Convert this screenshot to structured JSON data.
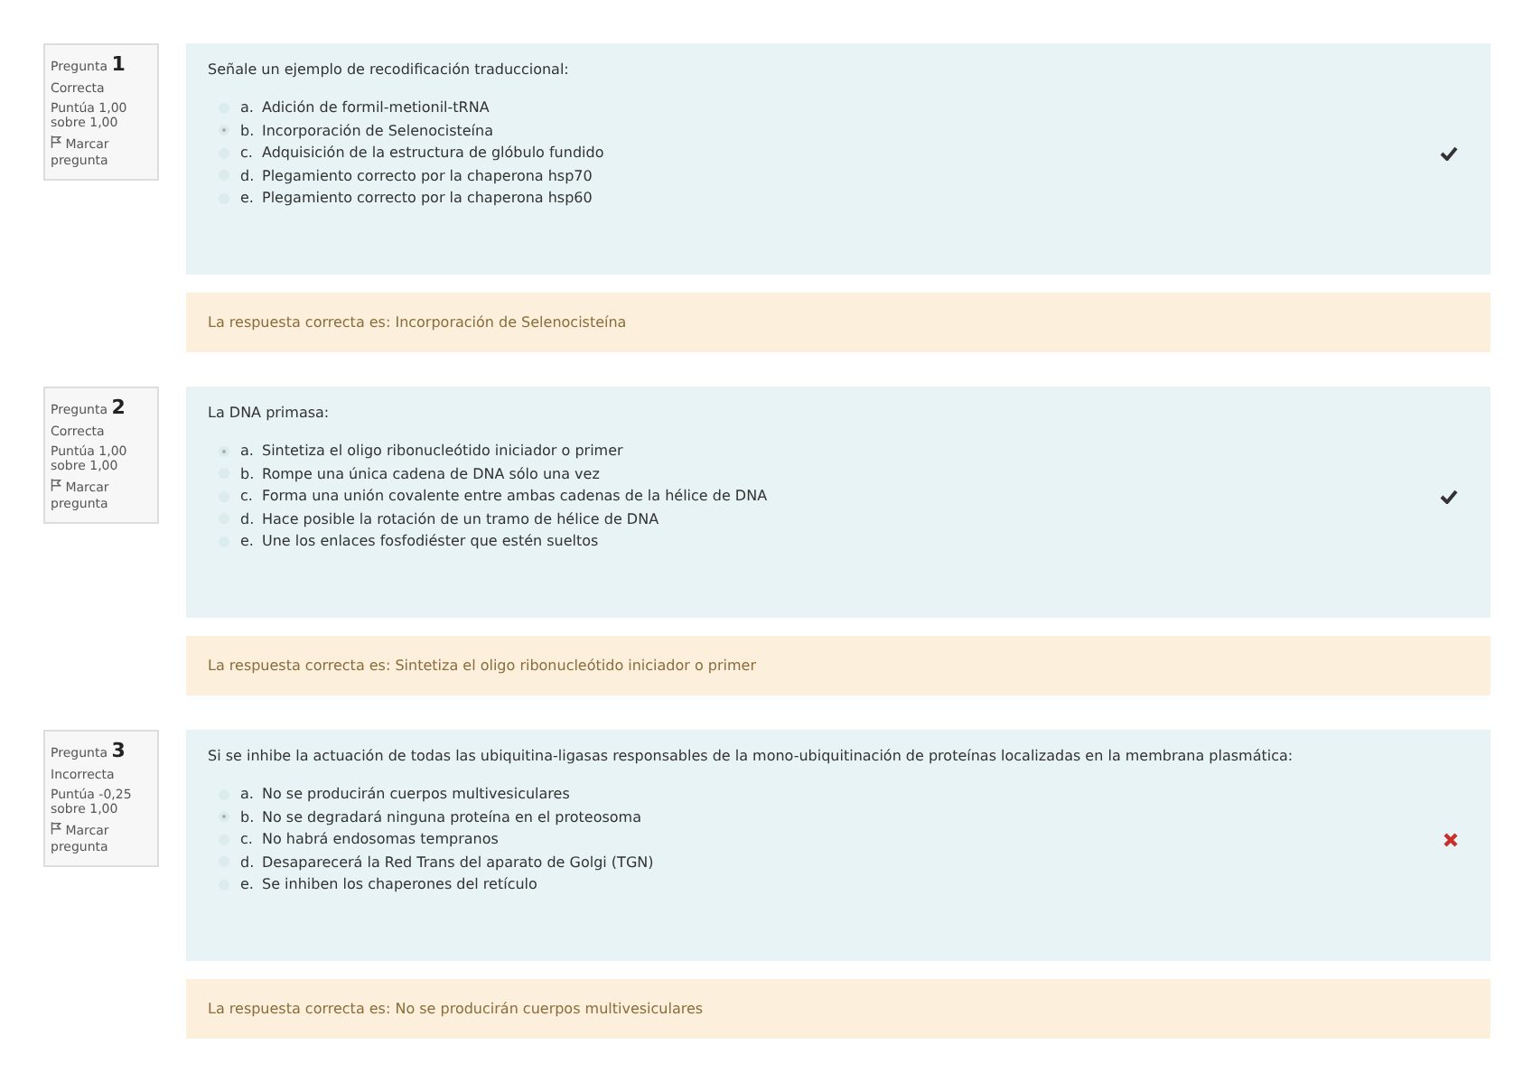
{
  "questions": [
    {
      "label": "Pregunta",
      "number": "1",
      "status": "Correcta",
      "score": "Puntúa 1,00 sobre 1,00",
      "flag": "Marcar pregunta",
      "kind": "correct",
      "text": "Señale un ejemplo de recodificación traduccional:",
      "options": [
        {
          "letter": "a.",
          "text": "Adición de formil-metionil-tRNA",
          "selected": false
        },
        {
          "letter": "b.",
          "text": "Incorporación de Selenocisteína",
          "selected": true
        },
        {
          "letter": "c.",
          "text": "Adquisición de la estructura de glóbulo fundido",
          "selected": false
        },
        {
          "letter": "d.",
          "text": "Plegamiento correcto por la chaperona hsp70",
          "selected": false
        },
        {
          "letter": "e.",
          "text": "Plegamiento correcto por la chaperona hsp60",
          "selected": false
        }
      ],
      "feedback": "La respuesta correcta es: Incorporación de Selenocisteína"
    },
    {
      "label": "Pregunta",
      "number": "2",
      "status": "Correcta",
      "score": "Puntúa 1,00 sobre 1,00",
      "flag": "Marcar pregunta",
      "kind": "correct",
      "text": "La DNA primasa:",
      "options": [
        {
          "letter": "a.",
          "text": "Sintetiza el oligo ribonucleótido iniciador o primer",
          "selected": true
        },
        {
          "letter": "b.",
          "text": "Rompe una única cadena de DNA sólo una vez",
          "selected": false
        },
        {
          "letter": "c.",
          "text": "Forma una unión covalente entre ambas cadenas de la hélice de DNA",
          "selected": false
        },
        {
          "letter": "d.",
          "text": "Hace posible la rotación de un tramo de hélice de DNA",
          "selected": false
        },
        {
          "letter": "e.",
          "text": "Une los enlaces fosfodiéster que estén sueltos",
          "selected": false
        }
      ],
      "feedback": "La respuesta correcta es: Sintetiza el oligo ribonucleótido iniciador o primer"
    },
    {
      "label": "Pregunta",
      "number": "3",
      "status": "Incorrecta",
      "score": "Puntúa -0,25 sobre 1,00",
      "flag": "Marcar pregunta",
      "kind": "incorrect",
      "text": "Si se inhibe la actuación de todas las ubiquitina-ligasas responsables de la mono-ubiquitinación de proteínas localizadas en la membrana plasmática:",
      "options": [
        {
          "letter": "a.",
          "text": "No se producirán cuerpos multivesiculares",
          "selected": false
        },
        {
          "letter": "b.",
          "text": "No se degradará ninguna proteína en el proteosoma",
          "selected": true
        },
        {
          "letter": "c.",
          "text": "No habrá endosomas tempranos",
          "selected": false
        },
        {
          "letter": "d.",
          "text": "Desaparecerá la Red Trans del aparato de Golgi (TGN)",
          "selected": false
        },
        {
          "letter": "e.",
          "text": "Se inhiben los chaperones del retículo",
          "selected": false
        }
      ],
      "feedback": "La respuesta correcta es: No se producirán cuerpos multivesiculares"
    }
  ]
}
